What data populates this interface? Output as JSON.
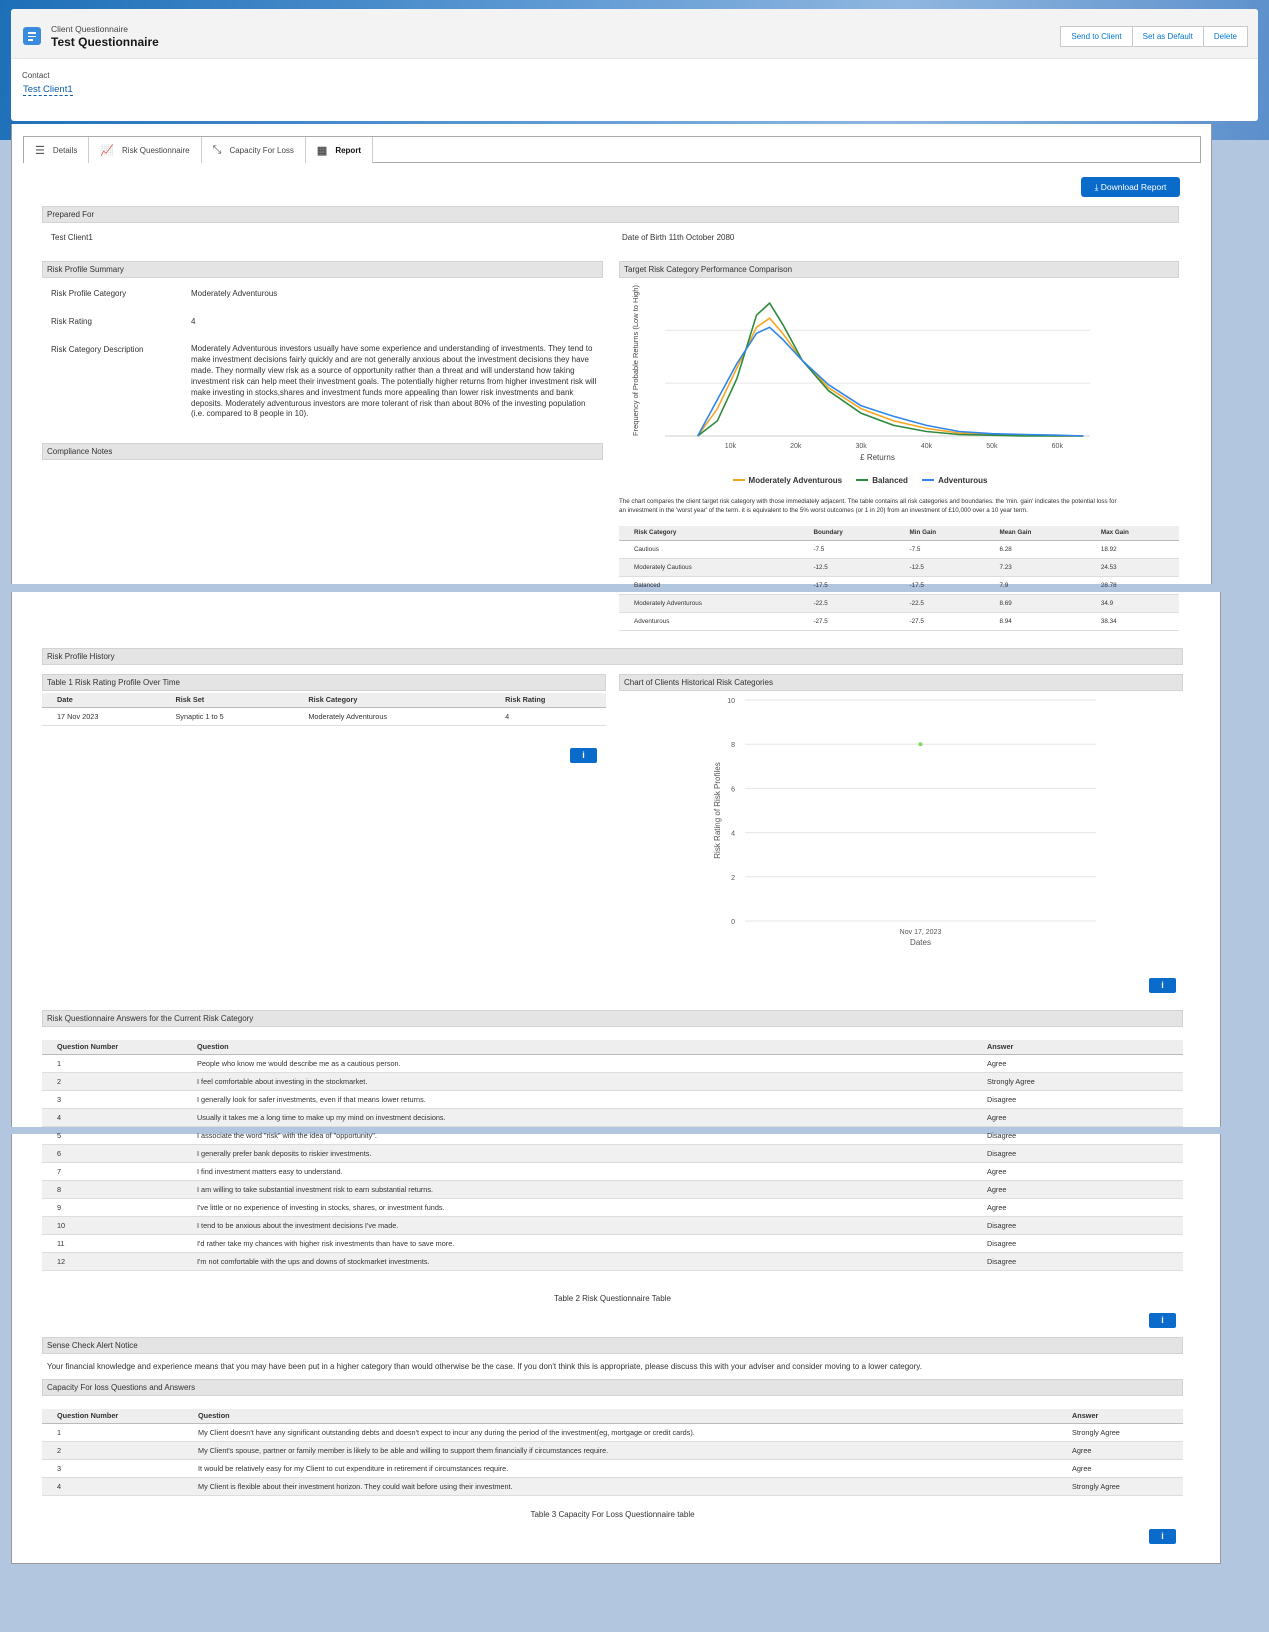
{
  "header": {
    "object_type": "Client Questionnaire",
    "title": "Test Questionnaire",
    "buttons": [
      "Send to Client",
      "Set as Default",
      "Delete"
    ],
    "contact_label": "Contact",
    "contact_value": "Test Client1"
  },
  "tabs": [
    {
      "label": "Details",
      "icon": "list-icon"
    },
    {
      "label": "Risk Questionnaire",
      "icon": "line-chart-icon"
    },
    {
      "label": "Capacity For Loss",
      "icon": "contract-arrows-icon"
    },
    {
      "label": "Report",
      "icon": "table-icon"
    }
  ],
  "download_label": "Download Report",
  "prepared": {
    "section": "Prepared For",
    "client": "Test Client1",
    "dob": "Date of Birth 11th October 2080"
  },
  "summary": {
    "section": "Risk Profile Summary",
    "category_label": "Risk Profile Category",
    "category_value": "Moderately Adventurous",
    "rating_label": "Risk Rating",
    "rating_value": "4",
    "desc_label": "Risk Category Description",
    "desc_lines": [
      "Moderately Adventurous investors usually have some experience and understanding of investments. They tend to",
      "make investment decisions fairly quickly and are not generally anxious about the investment decisions they have",
      "made. They normally view risk as a source of opportunity rather than a threat and will understand how taking",
      "investment risk can help meet their investment goals. The potentially higher returns from higher investment risk will",
      "make investing in stocks,shares and investment funds more appealing than lower risk investments and bank",
      "deposits. Moderately adventurous investors are more tolerant of risk than about 80% of the investing population",
      "(i.e. compared to 8 people in 10)."
    ]
  },
  "compliance": "Compliance Notes",
  "perf": {
    "section": "Target Risk Category Performance Comparison",
    "note_lines": [
      "The chart compares the client target risk category with those immediately adjacent. The table contains all risk categories and boundaries. the 'min. gain' indicates the potential loss for",
      "an investment in the 'worst year' of the term. it is equivalent to the 5% worst outcomes (or 1 in 20) from an investment of £10,000 over a 10 year term."
    ],
    "table_headers": [
      "Risk Category",
      "Boundary",
      "Min Gain",
      "Mean Gain",
      "Max Gain"
    ],
    "table_rows": [
      [
        "Cautious",
        "-7.5",
        "-7.5",
        "6.28",
        "18.92"
      ],
      [
        "Moderately Cautious",
        "-12.5",
        "-12.5",
        "7.23",
        "24.53"
      ],
      [
        "Balanced",
        "-17.5",
        "-17.5",
        "7.9",
        "28.78"
      ],
      [
        "Moderately Adventurous",
        "-22.5",
        "-22.5",
        "8.69",
        "34.9"
      ],
      [
        "Adventurous",
        "-27.5",
        "-27.5",
        "8.94",
        "38.34"
      ]
    ]
  },
  "history": {
    "section": "Risk Profile History",
    "table_title": "Table 1 Risk Rating Profile Over Time",
    "headers": [
      "Date",
      "Risk Set",
      "Risk Category",
      "Risk Rating"
    ],
    "rows": [
      [
        "17 Nov 2023",
        "Synaptic 1 to 5",
        "Moderately Adventurous",
        "4"
      ]
    ],
    "chart_title": "Chart of Clients Historical Risk Categories"
  },
  "answers": {
    "section": "Risk Questionnaire Answers for the Current Risk Category",
    "headers": [
      "Question Number",
      "Question",
      "Answer"
    ],
    "rows": [
      [
        "1",
        "People who know me would describe me as a cautious person.",
        "Agree"
      ],
      [
        "2",
        "I feel comfortable about investing in the stockmarket.",
        "Strongly Agree"
      ],
      [
        "3",
        "I generally look for safer investments, even if that means lower returns.",
        "Disagree"
      ],
      [
        "4",
        "Usually it takes me a long time to make up my mind on investment decisions.",
        "Agree"
      ],
      [
        "5",
        "I associate the word \"risk\" with the idea of \"opportunity\".",
        "Disagree"
      ],
      [
        "6",
        "I generally prefer bank deposits to riskier investments.",
        "Disagree"
      ],
      [
        "7",
        "I find investment matters easy to understand.",
        "Agree"
      ],
      [
        "8",
        "I am willing to take substantial investment risk to earn substantial returns.",
        "Agree"
      ],
      [
        "9",
        "I've little or no experience of investing in stocks, shares, or investment funds.",
        "Agree"
      ],
      [
        "10",
        "I tend to be anxious about the investment decisions I've made.",
        "Disagree"
      ],
      [
        "11",
        "I'd rather take my chances with higher risk investments than have to save more.",
        "Disagree"
      ],
      [
        "12",
        "I'm not comfortable with the ups and downs of stockmarket investments.",
        "Disagree"
      ]
    ],
    "caption": "Table 2 Risk Questionnaire Table"
  },
  "sense": {
    "section": "Sense Check Alert Notice",
    "text": "Your financial knowledge and experience means that you may have been put in a higher category than would otherwise be the case. If you don't think this is appropriate, please discuss this with your adviser and consider moving to a lower category."
  },
  "cfl": {
    "section": "Capacity For loss Questions and Answers",
    "headers": [
      "Question Number",
      "Question",
      "Answer"
    ],
    "rows": [
      [
        "1",
        "My Client doesn't have any significant outstanding debts and doesn't expect to incur any during the period of the investment(eg, mortgage or credit cards).",
        "Strongly Agree"
      ],
      [
        "2",
        "My Client's spouse, partner or family member is likely to be able and willing to support them financially if circumstances require.",
        "Agree"
      ],
      [
        "3",
        "It would be relatively easy for my Client to cut expenditure in retirement if circumstances require.",
        "Agree"
      ],
      [
        "4",
        "My Client is flexible about their investment horizon. They could wait before using their investment.",
        "Strongly Agree"
      ]
    ],
    "caption": "Table 3 Capacity For Loss Questionnaire table"
  },
  "info_label": "i",
  "chart_data": [
    {
      "type": "line",
      "title": "",
      "xlabel": "£ Returns",
      "ylabel": "Frequency of Probable Returns (Low to High)",
      "x_ticks": [
        "10k",
        "20k",
        "30k",
        "40k",
        "50k",
        "60k"
      ],
      "xlim": [
        0,
        65000
      ],
      "x": [
        5000,
        8000,
        11000,
        14000,
        16000,
        18000,
        21000,
        25000,
        30000,
        35000,
        40000,
        45000,
        50000,
        55000,
        60000,
        64000
      ],
      "series": [
        {
          "name": "Moderately Adventurous",
          "color": "#f5a623",
          "values": [
            0,
            0.18,
            0.45,
            0.72,
            0.78,
            0.68,
            0.5,
            0.32,
            0.18,
            0.1,
            0.05,
            0.02,
            0.01,
            0.005,
            0,
            0
          ]
        },
        {
          "name": "Balanced",
          "color": "#2e8b3e",
          "values": [
            0,
            0.1,
            0.38,
            0.8,
            0.88,
            0.74,
            0.5,
            0.3,
            0.15,
            0.07,
            0.03,
            0.01,
            0.005,
            0,
            0,
            0
          ]
        },
        {
          "name": "Adventurous",
          "color": "#2f86eb",
          "values": [
            0,
            0.24,
            0.48,
            0.68,
            0.72,
            0.64,
            0.5,
            0.34,
            0.2,
            0.13,
            0.07,
            0.03,
            0.015,
            0.01,
            0.005,
            0
          ]
        }
      ]
    },
    {
      "type": "scatter",
      "title": "",
      "xlabel": "Dates",
      "ylabel": "Risk Rating of Risk Profiles",
      "ylim": [
        0,
        10
      ],
      "y_ticks": [
        "0",
        "2",
        "4",
        "6",
        "8",
        "10"
      ],
      "x_ticks": [
        "Nov 17, 2023"
      ],
      "points": [
        {
          "x": "Nov 17, 2023",
          "y": 8
        }
      ],
      "color": "#7ed957"
    }
  ]
}
